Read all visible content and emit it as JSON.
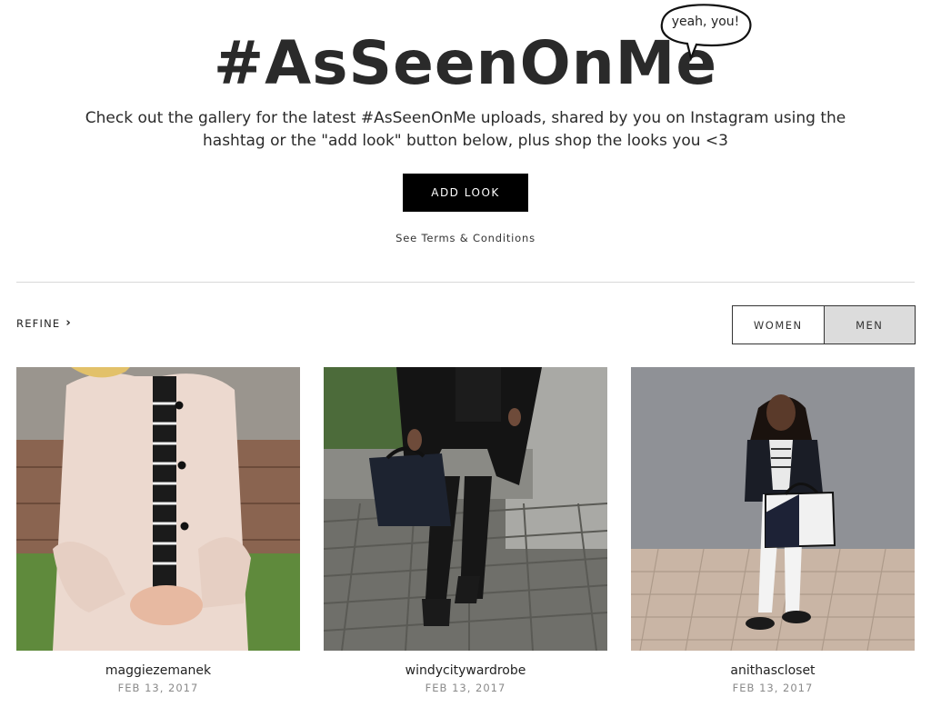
{
  "hero": {
    "title": "#AsSeenOnMe",
    "bubble_text": "yeah, you!",
    "subtitle": "Check out the gallery for the latest #AsSeenOnMe uploads, shared by you on Instagram using the hashtag or the \"add look\" button below, plus shop the looks you <3",
    "add_look_label": "ADD LOOK",
    "terms_link": "See Terms & Conditions"
  },
  "filters": {
    "refine_label": "REFINE",
    "refine_icon": "chevron-right-icon",
    "gender_options": [
      "WOMEN",
      "MEN"
    ],
    "selected_gender": "WOMEN"
  },
  "gallery": [
    {
      "username": "maggiezemanek",
      "date": "FEB 13, 2017"
    },
    {
      "username": "windycitywardrobe",
      "date": "FEB 13, 2017"
    },
    {
      "username": "anithascloset",
      "date": "FEB 13, 2017"
    }
  ],
  "colors": {
    "button_bg": "#000000",
    "inactive_toggle_bg": "#dcdcdc",
    "date_text": "#8a8a8a"
  }
}
